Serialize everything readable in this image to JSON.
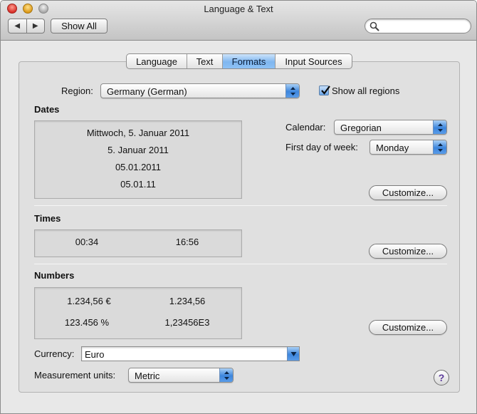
{
  "window": {
    "title": "Language & Text"
  },
  "toolbar": {
    "back_icon": "back-arrow-icon",
    "forward_icon": "forward-arrow-icon",
    "back_glyph": "◀",
    "forward_glyph": "▶",
    "show_all_label": "Show All",
    "search_value": "",
    "search_icon": "search-icon"
  },
  "tabs": [
    {
      "label": "Language",
      "selected": false
    },
    {
      "label": "Text",
      "selected": false
    },
    {
      "label": "Formats",
      "selected": true
    },
    {
      "label": "Input Sources",
      "selected": false
    }
  ],
  "region": {
    "label": "Region:",
    "value": "Germany (German)",
    "show_all_regions_label": "Show all regions",
    "show_all_regions_checked": true
  },
  "dates": {
    "heading": "Dates",
    "samples": [
      "Mittwoch, 5. Januar 2011",
      "5. Januar 2011",
      "05.01.2011",
      "05.01.11"
    ],
    "calendar_label": "Calendar:",
    "calendar_value": "Gregorian",
    "first_day_label": "First day of week:",
    "first_day_value": "Monday",
    "customize_label": "Customize..."
  },
  "times": {
    "heading": "Times",
    "samples": [
      "00:34",
      "16:56"
    ],
    "customize_label": "Customize..."
  },
  "numbers": {
    "heading": "Numbers",
    "samples": [
      "1.234,56 €",
      "1.234,56",
      "123.456 %",
      "1,23456E3"
    ],
    "customize_label": "Customize..."
  },
  "currency": {
    "label": "Currency:",
    "value": "Euro"
  },
  "measurement": {
    "label": "Measurement units:",
    "value": "Metric"
  },
  "help": {
    "label": "?",
    "icon": "help-icon"
  },
  "colors": {
    "accent": "#3d86dd",
    "selected_tab": "#8dc1f5"
  }
}
